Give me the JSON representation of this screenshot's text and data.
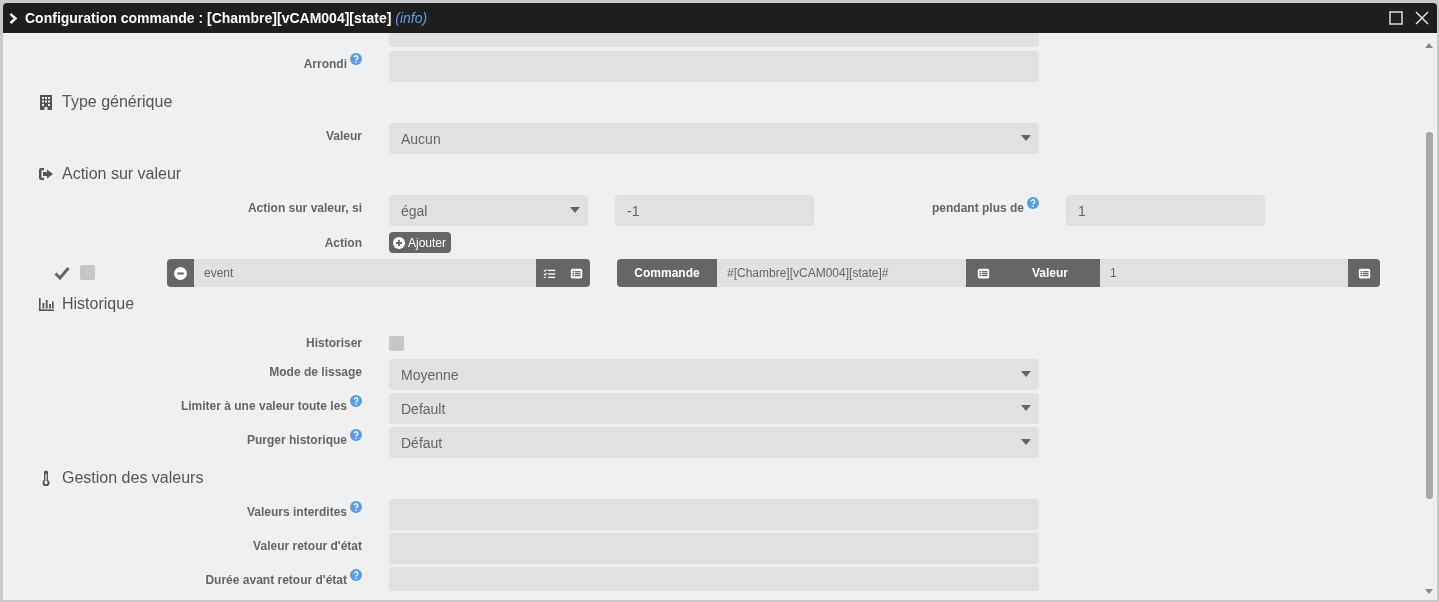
{
  "window": {
    "title": "Configuration commande : [Chambre][vCAM004][state] *(info)*"
  },
  "rows": [
    {
      "kind": "clipped"
    },
    {
      "kind": "field",
      "label": "Arrondi",
      "help": true
    },
    {
      "kind": "header",
      "text": "Type générique"
    },
    {
      "kind": "select",
      "label": "Valeur",
      "help": false,
      "value": "Aucun"
    },
    {
      "kind": "header",
      "text": "Action sur valeur"
    },
    {
      "kind": "condition",
      "label": "Action sur valeur, si",
      "help": false,
      "operator": "égal",
      "value": "-1",
      "duration_label": "pendant plus de",
      "duration_help": true,
      "duration": "1"
    },
    {
      "kind": "button",
      "label": "Action",
      "help": false,
      "button": "Ajouter"
    },
    {
      "kind": "action",
      "enabled": true,
      "options_checked": false,
      "command": "event",
      "type_label": "Commande",
      "target": "#[Chambre][vCAM004][state]#",
      "value_label": "Valeur",
      "value": "1"
    },
    {
      "kind": "header",
      "text": "Historique"
    },
    {
      "kind": "checkbox",
      "label": "Historiser",
      "help": false,
      "checked": false
    },
    {
      "kind": "select",
      "label": "Mode de lissage",
      "help": false,
      "value": "Moyenne"
    },
    {
      "kind": "select",
      "label": "Limiter à une valeur toute les",
      "help": true,
      "value": "Default"
    },
    {
      "kind": "select",
      "label": "Purger historique",
      "help": true,
      "value": "Défaut"
    },
    {
      "kind": "header",
      "text": "Gestion des valeurs"
    },
    {
      "kind": "field",
      "label": "Valeurs interdites",
      "help": true
    },
    {
      "kind": "field",
      "label": "Valeur retour d'état",
      "help": false
    },
    {
      "kind": "field",
      "label": "Durée avant retour d'état",
      "help": true
    }
  ]
}
